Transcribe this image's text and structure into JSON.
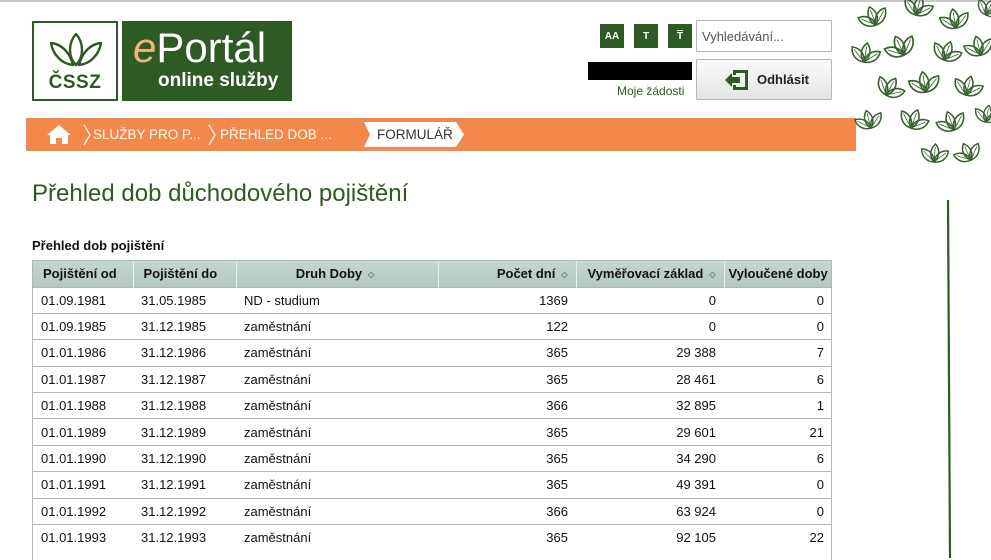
{
  "header": {
    "logo_cssz": "ČSSZ",
    "logo_eportal_prefix": "e",
    "logo_eportal_main": "Portál",
    "logo_eportal_sub": "online služby",
    "tools": {
      "font_size_label": "AA",
      "text_only_label": "T",
      "contrast_label": "T"
    },
    "search_placeholder": "Vyhledávání...",
    "moje_zadosti": "Moje žádosti",
    "logout_label": "Odhlásit"
  },
  "breadcrumb": {
    "items": [
      "SLUŽBY PRO P...",
      "PŘEHLED DOB ..."
    ],
    "current": "FORMULÁŘ"
  },
  "colors": {
    "brand_green": "#2e5a23",
    "breadcrumb_orange": "#f4874a",
    "logo_accent": "#f0b37e"
  },
  "main": {
    "page_title": "Přehled dob důchodového pojištění",
    "section_label": "Přehled dob pojištění",
    "table": {
      "columns": [
        "Pojištění od",
        "Pojištění do",
        "Druh Doby",
        "Počet dní",
        "Vyměřovací základ",
        "Vyloučené doby"
      ],
      "rows": [
        [
          "01.09.1981",
          "31.05.1985",
          "ND - studium",
          "1369",
          "0",
          "0"
        ],
        [
          "01.09.1985",
          "31.12.1985",
          "zaměstnání",
          "122",
          "0",
          "0"
        ],
        [
          "01.01.1986",
          "31.12.1986",
          "zaměstnání",
          "365",
          "29 388",
          "7"
        ],
        [
          "01.01.1987",
          "31.12.1987",
          "zaměstnání",
          "365",
          "28 461",
          "6"
        ],
        [
          "01.01.1988",
          "31.12.1988",
          "zaměstnání",
          "366",
          "32 895",
          "1"
        ],
        [
          "01.01.1989",
          "31.12.1989",
          "zaměstnání",
          "365",
          "29 601",
          "21"
        ],
        [
          "01.01.1990",
          "31.12.1990",
          "zaměstnání",
          "365",
          "34 290",
          "6"
        ],
        [
          "01.01.1991",
          "31.12.1991",
          "zaměstnání",
          "365",
          "49 391",
          "0"
        ],
        [
          "01.01.1992",
          "31.12.1992",
          "zaměstnání",
          "366",
          "63 924",
          "0"
        ],
        [
          "01.01.1993",
          "31.12.1993",
          "zaměstnání",
          "365",
          "92 105",
          "22"
        ]
      ]
    }
  }
}
